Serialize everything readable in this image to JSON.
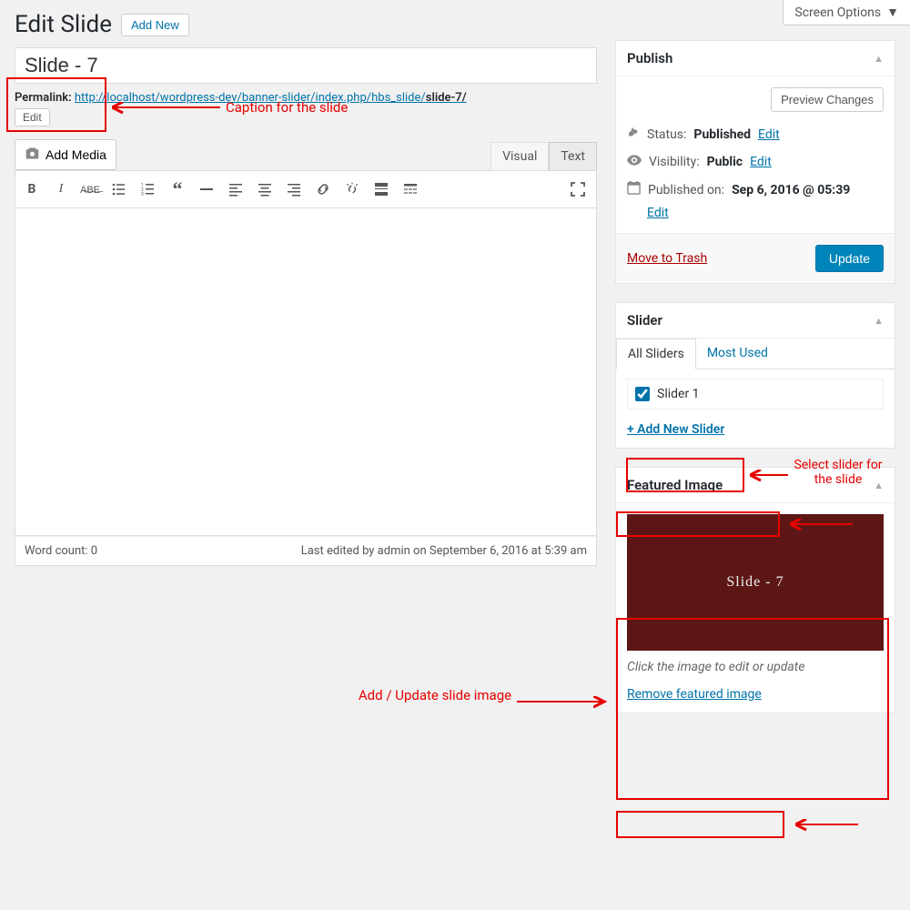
{
  "screen_options": "Screen Options",
  "page_title": "Edit Slide",
  "add_new": "Add New",
  "title_value": "Slide - 7",
  "permalink_label": "Permalink:",
  "permalink_base": "http://localhost/wordpress-dev/banner-slider/index.php/hbs_slide/",
  "permalink_slug": "slide-7/",
  "permalink_edit": "Edit",
  "add_media": "Add Media",
  "tabs": {
    "visual": "Visual",
    "text": "Text"
  },
  "word_count": "Word count: 0",
  "last_edited": "Last edited by admin on September 6, 2016 at 5:39 am",
  "publish": {
    "title": "Publish",
    "preview": "Preview Changes",
    "status_label": "Status:",
    "status_value": "Published",
    "visibility_label": "Visibility:",
    "visibility_value": "Public",
    "published_label": "Published on:",
    "published_value": "Sep 6, 2016 @ 05:39",
    "edit": "Edit",
    "trash": "Move to Trash",
    "update": "Update"
  },
  "slider": {
    "title": "Slider",
    "tab_all": "All Sliders",
    "tab_most": "Most Used",
    "item": "Slider 1",
    "add_new": "+ Add New Slider"
  },
  "featured": {
    "title": "Featured Image",
    "overlay": "Slide - 7",
    "hint": "Click the image to edit or update",
    "remove": "Remove featured image"
  },
  "annotations": {
    "caption": "Caption for the slide",
    "select_slider": "Select slider for the slide",
    "update_image": "Add  / Update slide image"
  }
}
